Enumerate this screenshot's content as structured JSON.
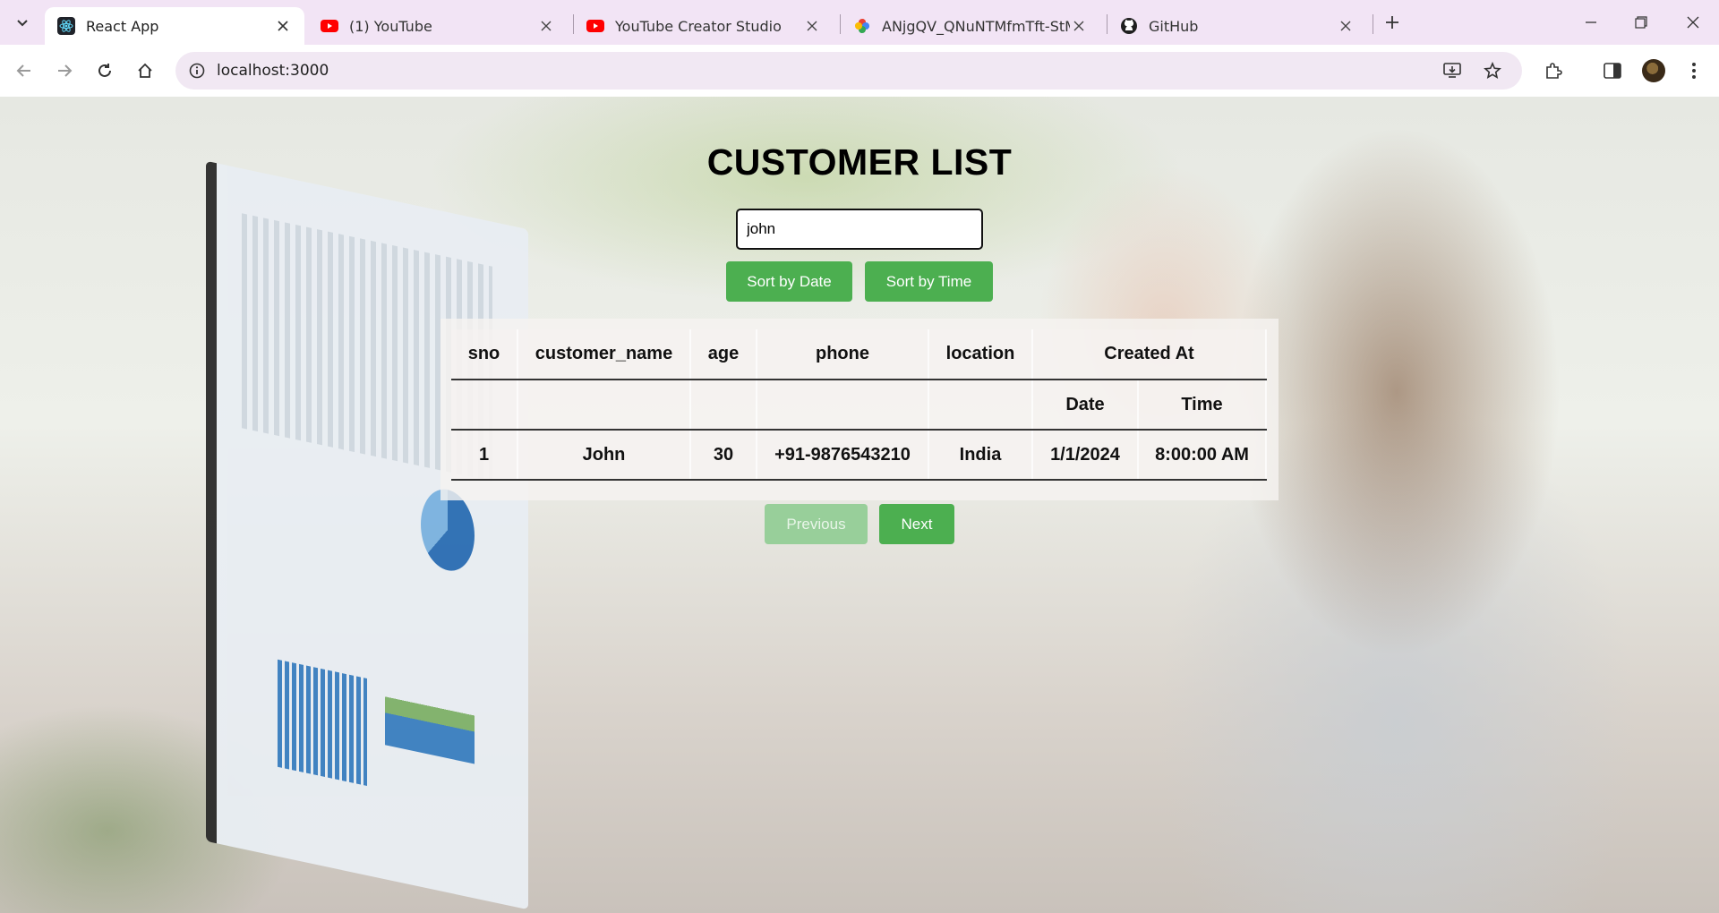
{
  "browser": {
    "tabs": [
      {
        "title": "React App",
        "icon": "react-icon",
        "active": true
      },
      {
        "title": "(1) YouTube",
        "icon": "youtube-icon",
        "active": false
      },
      {
        "title": "YouTube Creator Studio",
        "icon": "youtube-studio-icon",
        "active": false
      },
      {
        "title": "ANjgQV_QNuNTMfmTft-StMoy",
        "icon": "google-photos-icon",
        "active": false
      },
      {
        "title": "GitHub",
        "icon": "github-icon",
        "active": false
      }
    ],
    "url": "localhost:3000"
  },
  "page": {
    "title": "CUSTOMER LIST",
    "search_value": "john",
    "sort_date_label": "Sort by Date",
    "sort_time_label": "Sort by Time",
    "table": {
      "headers": {
        "sno": "sno",
        "customer_name": "customer_name",
        "age": "age",
        "phone": "phone",
        "location": "location",
        "created_at": "Created At",
        "date": "Date",
        "time": "Time"
      },
      "rows": [
        {
          "sno": "1",
          "customer_name": "John",
          "age": "30",
          "phone": "+91-9876543210",
          "location": "India",
          "date": "1/1/2024",
          "time": "8:00:00 AM"
        }
      ]
    },
    "previous_label": "Previous",
    "next_label": "Next",
    "colors": {
      "button_green": "#4caf50",
      "button_green_disabled": "#98cf9a"
    }
  }
}
